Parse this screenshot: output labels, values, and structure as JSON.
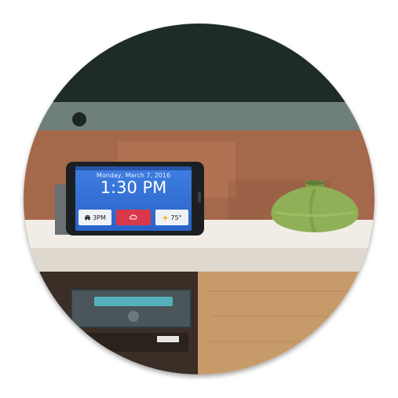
{
  "scene": {
    "description_free": true,
    "colors": {
      "tv": "#1e2b26",
      "wall": "#a4684b",
      "shelf": "#f1ede6",
      "vase": "#8fb056",
      "screen": "#2f6fd6",
      "alert": "#d8384a"
    }
  },
  "phone": {
    "date": "Monday, March 7, 2016",
    "time": "1:30 PM",
    "widgets": [
      {
        "icon": "car-icon",
        "value": "3PM"
      },
      {
        "icon": "cloud-alert-icon",
        "value": ""
      },
      {
        "icon": "sun-icon",
        "value": "75°"
      }
    ]
  }
}
